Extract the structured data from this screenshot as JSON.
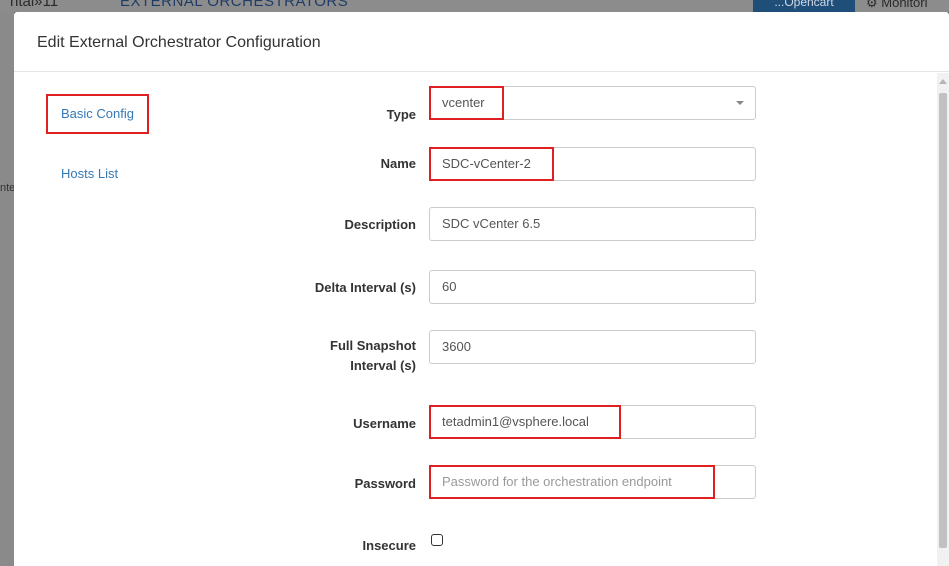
{
  "backdrop": {
    "left_fragment": "ntal»11",
    "heading": "EXTERNAL ORCHESTRATORS",
    "button": "...Opencart",
    "monitor": "⚙ Monitori",
    "side_fragment": "nte"
  },
  "modal": {
    "title": "Edit External Orchestrator Configuration"
  },
  "nav": {
    "items": [
      {
        "label": "Basic Config",
        "active": true
      },
      {
        "label": "Hosts List",
        "active": false
      }
    ]
  },
  "form": {
    "type": {
      "label": "Type",
      "value": "vcenter"
    },
    "name": {
      "label": "Name",
      "value": "SDC-vCenter-2"
    },
    "description": {
      "label": "Description",
      "value": "SDC vCenter 6.5"
    },
    "delta_interval": {
      "label": "Delta Interval (s)",
      "value": "60"
    },
    "full_snapshot_interval": {
      "label_line1": "Full Snapshot",
      "label_line2": "Interval (s)",
      "value": "3600"
    },
    "username": {
      "label": "Username",
      "value": "tetadmin1@vsphere.local"
    },
    "password": {
      "label": "Password",
      "value": "",
      "placeholder": "Password for the orchestration endpoint"
    },
    "insecure": {
      "label": "Insecure",
      "checked": false
    }
  },
  "colors": {
    "highlight": "#e02020",
    "link": "#337ab7"
  }
}
